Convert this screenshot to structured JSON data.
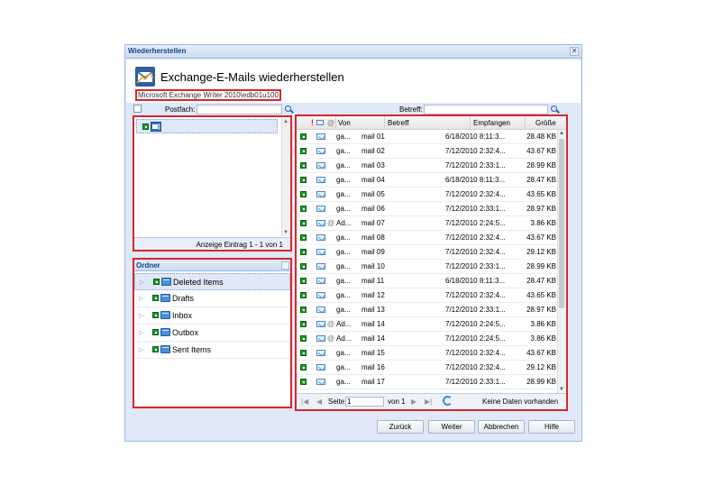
{
  "window": {
    "title": "Wiederherstellen",
    "close": "✕"
  },
  "header": {
    "title": "Exchange-E-Mails wiederherstellen",
    "subtitle": "Microsoft Exchange Writer 2010\\edb01u100"
  },
  "mailbox": {
    "search_label": "Postfach:",
    "search_value": "",
    "footer": "Anzeige Eintrag 1 - 1 von 1"
  },
  "folders": {
    "title": "Ordner",
    "items": [
      "Deleted Items",
      "Drafts",
      "Inbox",
      "Outbox",
      "Sent Items"
    ]
  },
  "grid": {
    "search_label": "Betreff:",
    "search_value": "",
    "columns": {
      "flag": "!",
      "from": "Von",
      "subject": "Betreff",
      "received": "Empfangen",
      "size": "Größe"
    },
    "rows": [
      {
        "from": "ga...",
        "subject": "mail 01",
        "received": "6/18/2010 8:11:3...",
        "size": "28.48 KB",
        "attach": false
      },
      {
        "from": "ga...",
        "subject": "mail 02",
        "received": "7/12/2010 2:32:4...",
        "size": "43.67 KB",
        "attach": false
      },
      {
        "from": "ga...",
        "subject": "mail 03",
        "received": "7/12/2010 2:33:1...",
        "size": "28.99 KB",
        "attach": false
      },
      {
        "from": "ga...",
        "subject": "mail 04",
        "received": "6/18/2010 8:11:3...",
        "size": "28.47 KB",
        "attach": false
      },
      {
        "from": "ga...",
        "subject": "mail 05",
        "received": "7/12/2010 2:32:4...",
        "size": "43.65 KB",
        "attach": false
      },
      {
        "from": "ga...",
        "subject": "mail 06",
        "received": "7/12/2010 2:33:1...",
        "size": "28.97 KB",
        "attach": false
      },
      {
        "from": "Ad...",
        "subject": "mail 07",
        "received": "7/12/2010 2:24:5...",
        "size": "3.86 KB",
        "attach": true
      },
      {
        "from": "ga...",
        "subject": "mail 08",
        "received": "7/12/2010 2:32:4...",
        "size": "43.67 KB",
        "attach": false
      },
      {
        "from": "ga...",
        "subject": "mail 09",
        "received": "7/12/2010 2:32:4...",
        "size": "29.12 KB",
        "attach": false
      },
      {
        "from": "ga...",
        "subject": "mail 10",
        "received": "7/12/2010 2:33:1...",
        "size": "28.99 KB",
        "attach": false
      },
      {
        "from": "ga...",
        "subject": "mail 11",
        "received": "6/18/2010 8:11:3...",
        "size": "28.47 KB",
        "attach": false
      },
      {
        "from": "ga...",
        "subject": "mail 12",
        "received": "7/12/2010 2:32:4...",
        "size": "43.65 KB",
        "attach": false
      },
      {
        "from": "ga...",
        "subject": "mail 13",
        "received": "7/12/2010 2:33:1...",
        "size": "28.97 KB",
        "attach": false
      },
      {
        "from": "Ad...",
        "subject": "mail 14",
        "received": "7/12/2010 2:24:5...",
        "size": "3.86 KB",
        "attach": true
      },
      {
        "from": "Ad...",
        "subject": "mail 14",
        "received": "7/12/2010 2:24:5...",
        "size": "3.86 KB",
        "attach": true
      },
      {
        "from": "ga...",
        "subject": "mail 15",
        "received": "7/12/2010 2:32:4...",
        "size": "43.67 KB",
        "attach": false
      },
      {
        "from": "ga...",
        "subject": "mail 16",
        "received": "7/12/2010 2:32:4...",
        "size": "29.12 KB",
        "attach": false
      },
      {
        "from": "ga...",
        "subject": "mail 17",
        "received": "7/12/2010 2:33:1...",
        "size": "28.99 KB",
        "attach": false
      }
    ],
    "pager": {
      "page_label": "Seite",
      "page_value": "1",
      "of_label": "von 1",
      "status": "Keine Daten vorhanden"
    }
  },
  "buttons": {
    "back": "Zurück",
    "next": "Weiter",
    "cancel": "Abbrechen",
    "help": "Hilfe"
  },
  "colors": {
    "highlight_border": "#d9262a",
    "panel_bg": "#dfe8f6",
    "title_text": "#15428b"
  }
}
